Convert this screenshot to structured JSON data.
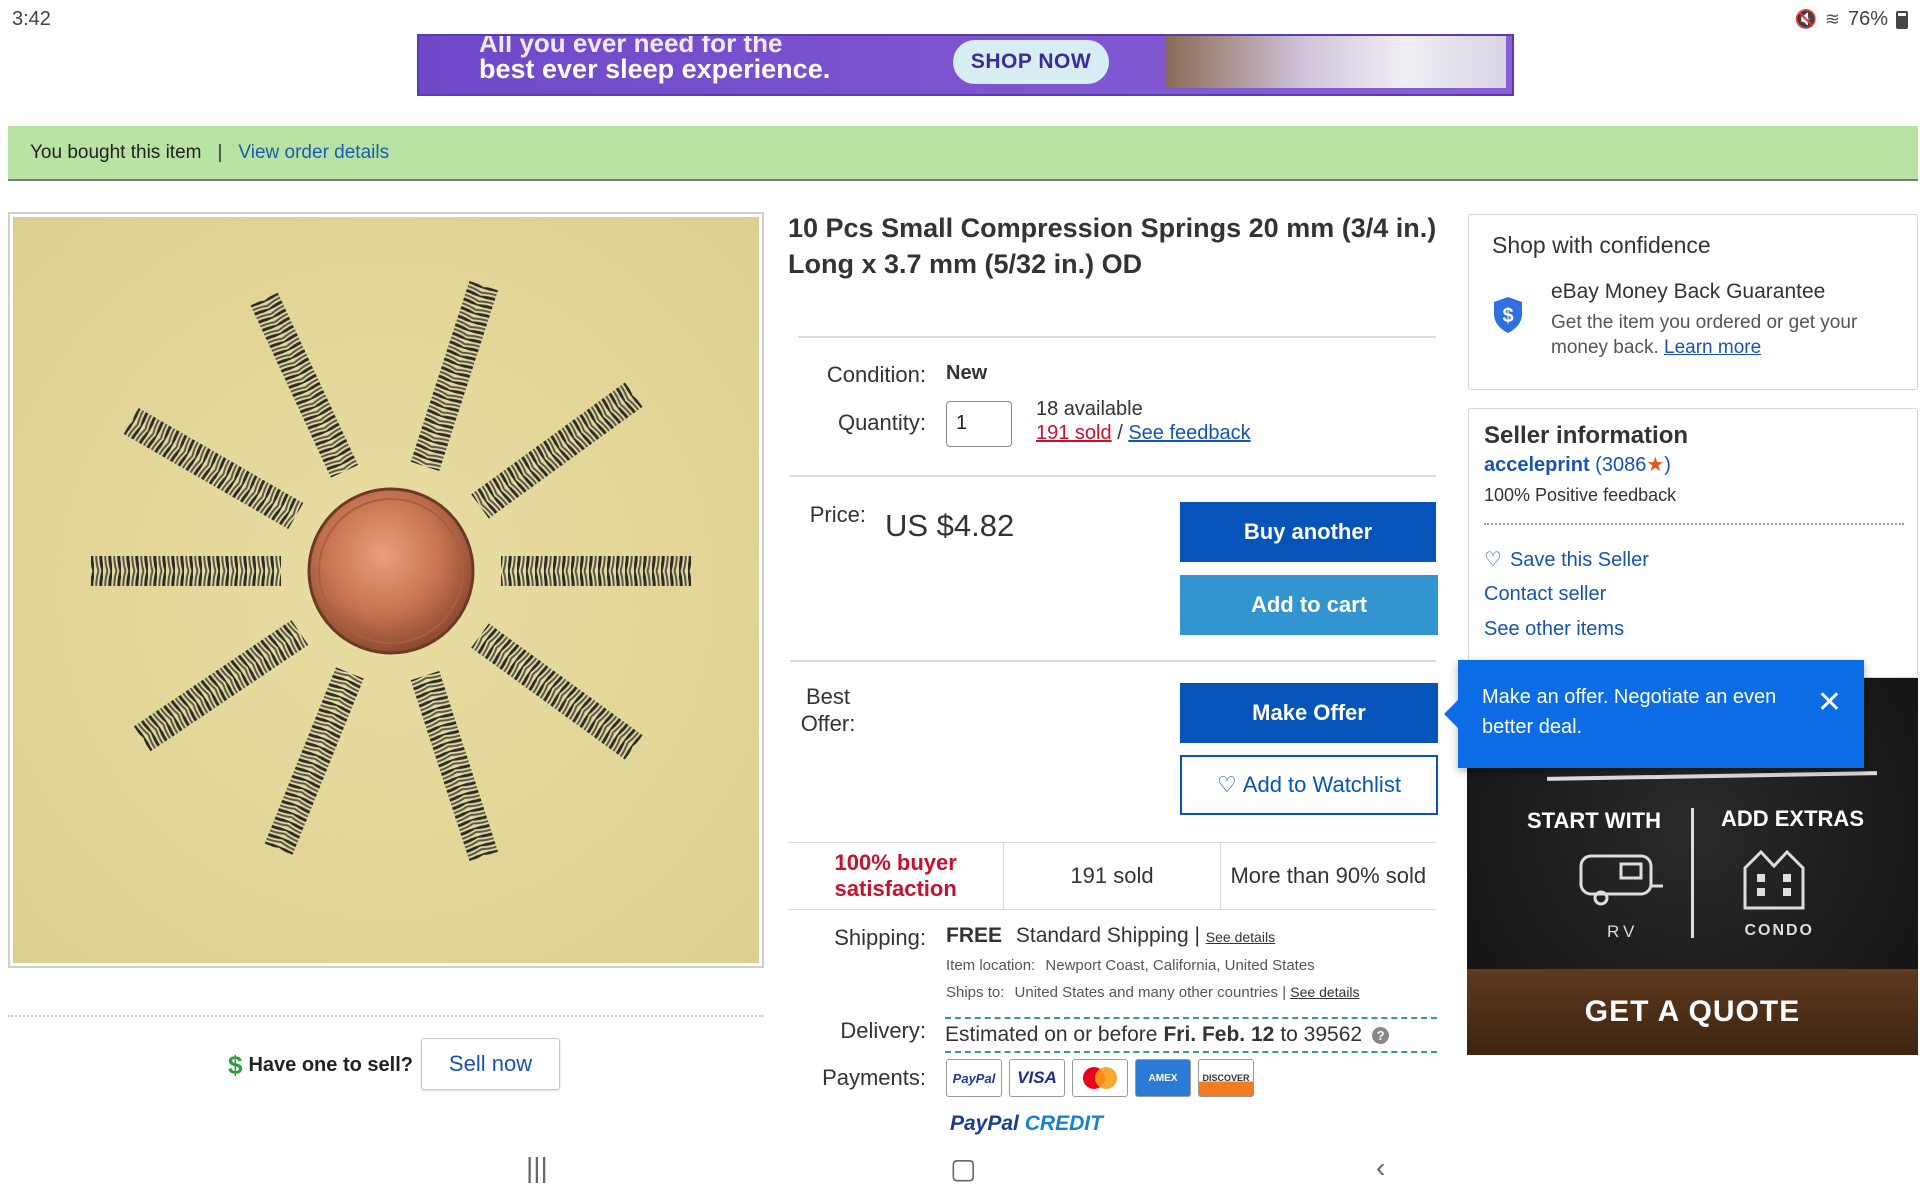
{
  "status_bar": {
    "time": "3:42",
    "battery": "76%"
  },
  "top_ad": {
    "line1": "All you ever need for the",
    "line2": "best ever sleep experience.",
    "cta": "SHOP NOW"
  },
  "order_banner": {
    "bought": "You bought this item",
    "separator": "|",
    "view_order": "View order details"
  },
  "listing": {
    "title": "10 Pcs Small Compression Springs 20 mm (3/4 in.) Long x 3.7 mm (5/32 in.) OD",
    "condition_label": "Condition:",
    "condition_value": "New",
    "quantity_label": "Quantity:",
    "quantity_value": "1",
    "available": "18 available",
    "sold_link": "191 sold",
    "slash": "/",
    "feedback_link": "See feedback",
    "price_label": "Price:",
    "price": "US $4.82",
    "buy_another": "Buy another",
    "add_to_cart": "Add to cart",
    "best_offer_label_1": "Best",
    "best_offer_label_2": "Offer:",
    "make_offer": "Make Offer",
    "watchlist_icon": "heart-icon",
    "add_to_watchlist": "Add to Watchlist",
    "stats": [
      {
        "text": "100% buyer satisfaction",
        "highlight": true
      },
      {
        "text": "191 sold",
        "highlight": false
      },
      {
        "text": "More than 90% sold",
        "highlight": false
      }
    ],
    "shipping_label": "Shipping:",
    "shipping_free": "FREE",
    "shipping_method": "Standard Shipping |",
    "shipping_details": "See details",
    "item_location_label": "Item location:",
    "item_location": "Newport Coast, California, United States",
    "ships_to_label": "Ships to:",
    "ships_to": "United States and many other countries |",
    "ships_to_details": "See details",
    "delivery_label": "Delivery:",
    "delivery_prefix": "Estimated on or before",
    "delivery_date": "Fri. Feb. 12",
    "delivery_suffix": "to 39562",
    "payments_label": "Payments:",
    "payment_methods": [
      "PayPal",
      "VISA",
      "Mastercard",
      "AMEX",
      "DISCOVER"
    ],
    "paypal_credit_1": "PayPal",
    "paypal_credit_2": "CREDIT"
  },
  "sell_prompt": {
    "question": "Have one to sell?",
    "button": "Sell now"
  },
  "confidence": {
    "title": "Shop with confidence",
    "guarantee": "eBay Money Back Guarantee",
    "desc": "Get the item you ordered or get your money back.",
    "learn_more": "Learn more"
  },
  "seller": {
    "title": "Seller information",
    "name": "acceleprint",
    "score": "3086",
    "positive": "100% Positive feedback",
    "save": "Save this Seller",
    "contact": "Contact seller",
    "other_items": "See other items"
  },
  "tooltip": {
    "text": "Make an offer. Negotiate an even better deal."
  },
  "side_ad": {
    "start_with": "START WITH",
    "add_extras": "ADD EXTRAS",
    "rv": "RV",
    "condo": "CONDO",
    "cta": "GET A QUOTE"
  },
  "colors": {
    "primary": "#0654ba",
    "secondary": "#3395d0",
    "banner_green": "#b9e3a2",
    "tooltip_blue": "#0c6ce6",
    "sold_red": "#c4122f"
  }
}
